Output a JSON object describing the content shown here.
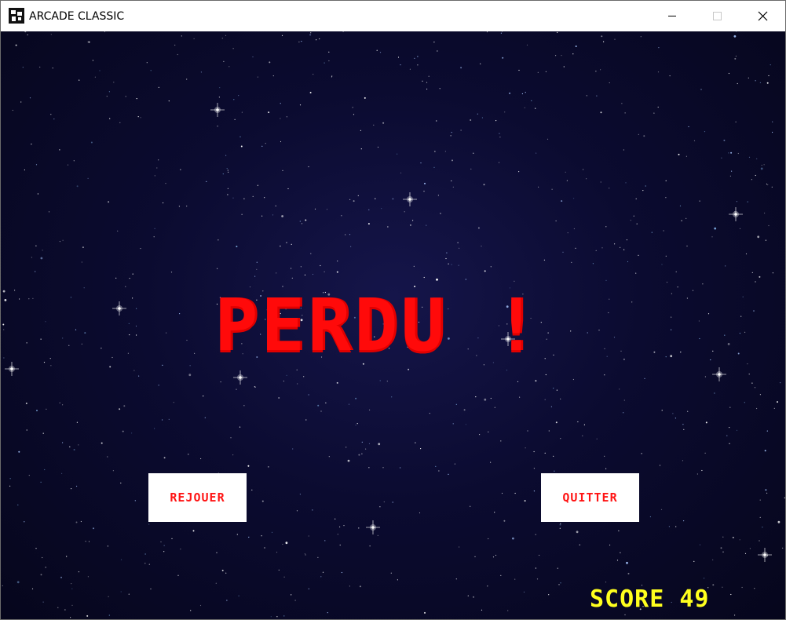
{
  "window": {
    "title": "ARCADE CLASSIC",
    "controls": {
      "minimize": "minimize-icon",
      "maximize": "maximize-icon",
      "close": "close-icon"
    }
  },
  "game": {
    "message": "PERDU !",
    "buttons": {
      "replay_label": "REJOUER",
      "quit_label": "QUITTER"
    },
    "score_text": "SCORE 49",
    "colors": {
      "message": "#ff0a0a",
      "button_text": "#ff1414",
      "button_bg": "#ffffff",
      "score": "#ffff1e",
      "background": "#0b0b30"
    }
  }
}
